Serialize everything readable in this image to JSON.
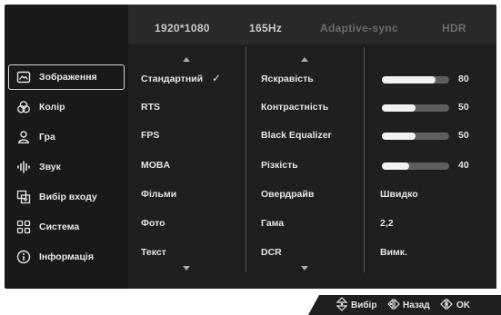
{
  "status_bar": {
    "resolution": "1920*1080",
    "refresh_rate": "165Hz",
    "adaptive_sync": "Adaptive-sync",
    "hdr": "HDR"
  },
  "sidebar": {
    "items": [
      {
        "label": "Зображення",
        "icon": "picture-icon",
        "active": true
      },
      {
        "label": "Колір",
        "icon": "color-circles-icon",
        "active": false
      },
      {
        "label": "Гра",
        "icon": "gamer-icon",
        "active": false
      },
      {
        "label": "Звук",
        "icon": "sound-wave-icon",
        "active": false
      },
      {
        "label": "Вибір входу",
        "icon": "input-select-icon",
        "active": false
      },
      {
        "label": "Система",
        "icon": "system-grid-icon",
        "active": false
      },
      {
        "label": "Інформація",
        "icon": "info-icon",
        "active": false
      }
    ]
  },
  "modes": {
    "items": [
      "Стандартний",
      "RTS",
      "FPS",
      "MOBA",
      "Фільми",
      "Фото",
      "Текст"
    ],
    "selected": "Стандартний"
  },
  "settings": {
    "items": [
      {
        "label": "Яскравість",
        "value": 80,
        "type": "slider"
      },
      {
        "label": "Контрастність",
        "value": 50,
        "type": "slider"
      },
      {
        "label": "Black Equalizer",
        "value": 50,
        "type": "slider"
      },
      {
        "label": "Різкість",
        "value": 40,
        "type": "slider"
      },
      {
        "label": "Овердрайв",
        "value": "Швидко",
        "type": "text"
      },
      {
        "label": "Гама",
        "value": "2,2",
        "type": "text"
      },
      {
        "label": "DCR",
        "value": "Вимк.",
        "type": "text"
      }
    ]
  },
  "help_bar": {
    "select": "Вибір",
    "back": "Назад",
    "ok": "OK"
  },
  "colors": {
    "osd_bg": "#18191b",
    "panel_bg": "#1e1f21",
    "slider_track": "#5c5e61",
    "slider_fill": "#f2f2f2"
  }
}
